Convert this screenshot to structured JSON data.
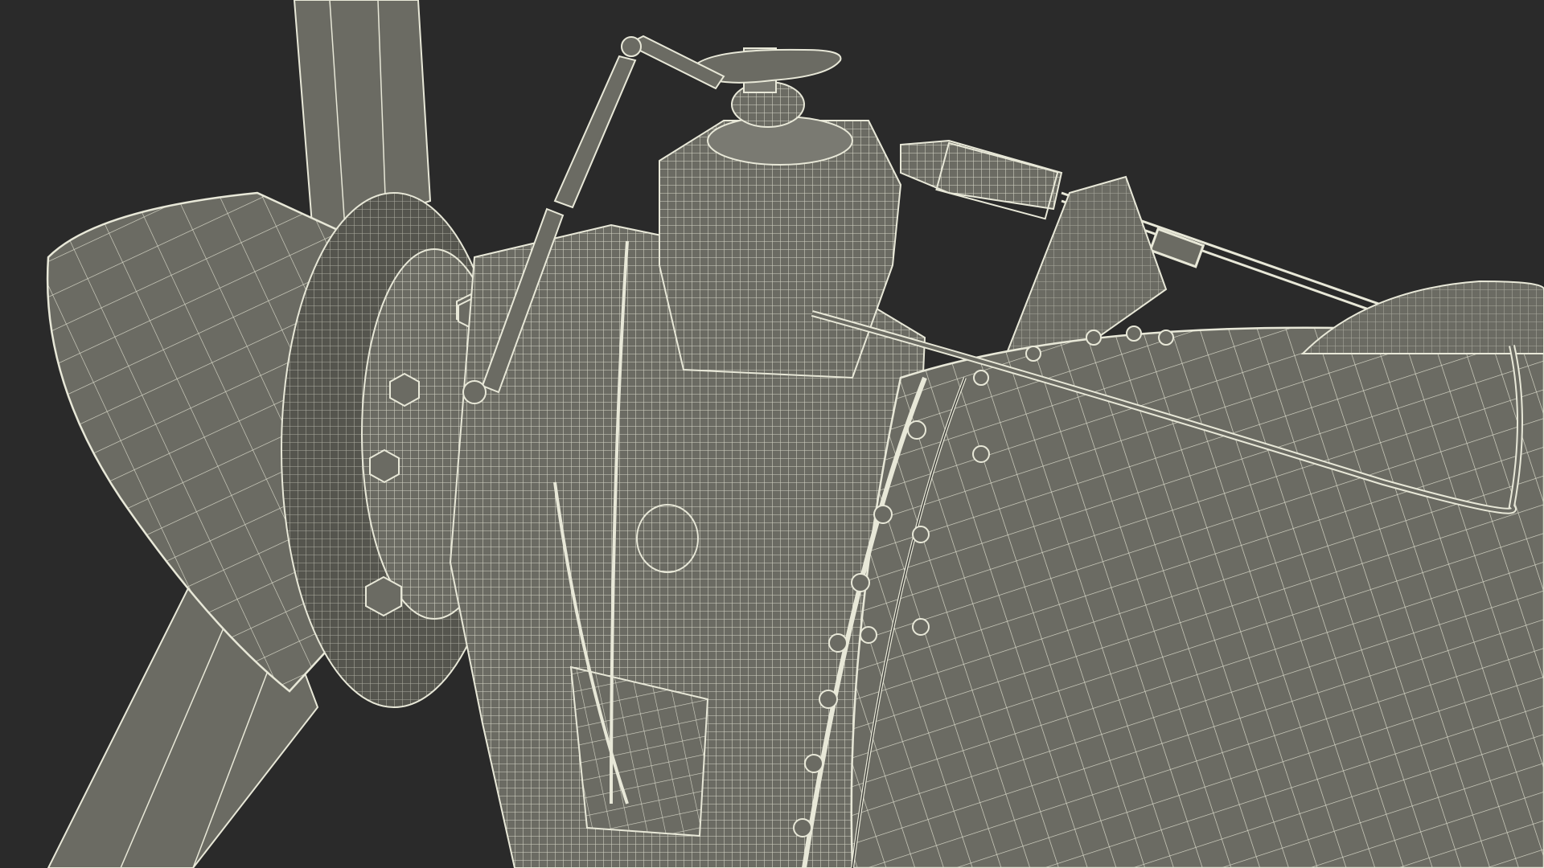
{
  "scene": {
    "subject": "wireframe-render-propeller-gearbox",
    "colors": {
      "background": "#2a2a2a",
      "mesh_fill": "#6b6b63",
      "mesh_fill_light": "#7a7a72",
      "mesh_fill_dark": "#55554e",
      "wire": "#e8e8d8",
      "edge_dark": "#3a3a36"
    }
  }
}
